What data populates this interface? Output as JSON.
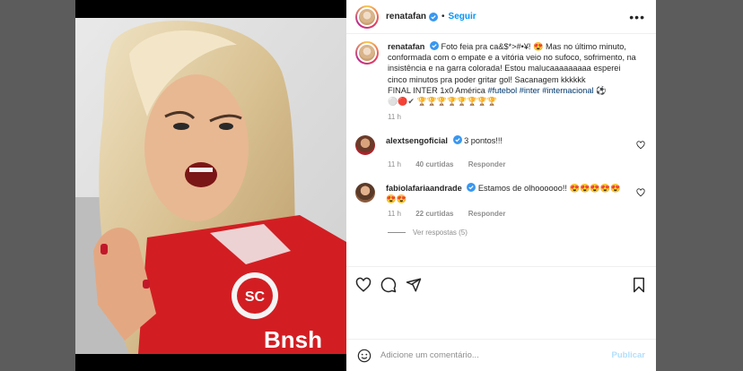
{
  "post": {
    "username": "renatafan",
    "follow_label": "Seguir",
    "more_label": "•••"
  },
  "caption": {
    "username": "renatafan",
    "text_line1": "Foto feia pra ca&$*>#•¥! 😍 Mas no último minuto, conformada com o empate e a vitória veio no sufoco, sofrimento, na insistência e na garra colorada! Estou malucaaaaaaaaa esperei cinco minutos pra poder gritar gol! Sacanagem kkkkkk",
    "text_line2_prefix": "FINAL INTER 1x0 América",
    "hashtags": [
      "#futebol",
      "#inter",
      "#internacional"
    ],
    "hashtag_suffix": "⚽",
    "emoji_line": "⚪🔴✔ 🏆🏆🏆🏆🏆🏆🏆🏆",
    "time": "11 h"
  },
  "comments": [
    {
      "username": "alextsengoficial",
      "text": "3 pontos!!!",
      "time": "11 h",
      "likes": "40 curtidas",
      "reply_label": "Responder"
    },
    {
      "username": "fabiolafariaandrade",
      "text": "Estamos de olhoooooo!! 😍😍😍😍😍😍😍",
      "time": "11 h",
      "likes": "22 curtidas",
      "reply_label": "Responder",
      "view_replies": "Ver respostas (5)"
    }
  ],
  "add_comment": {
    "placeholder": "Adicione um comentário...",
    "post_label": "Publicar"
  },
  "colors": {
    "link_blue": "#0095f6",
    "hashtag": "#00376b",
    "post_disabled": "#b2dffc"
  },
  "icons": [
    "verified-icon",
    "more-icon",
    "heart-icon",
    "comment-icon",
    "share-icon",
    "bookmark-icon",
    "emoji-icon"
  ]
}
